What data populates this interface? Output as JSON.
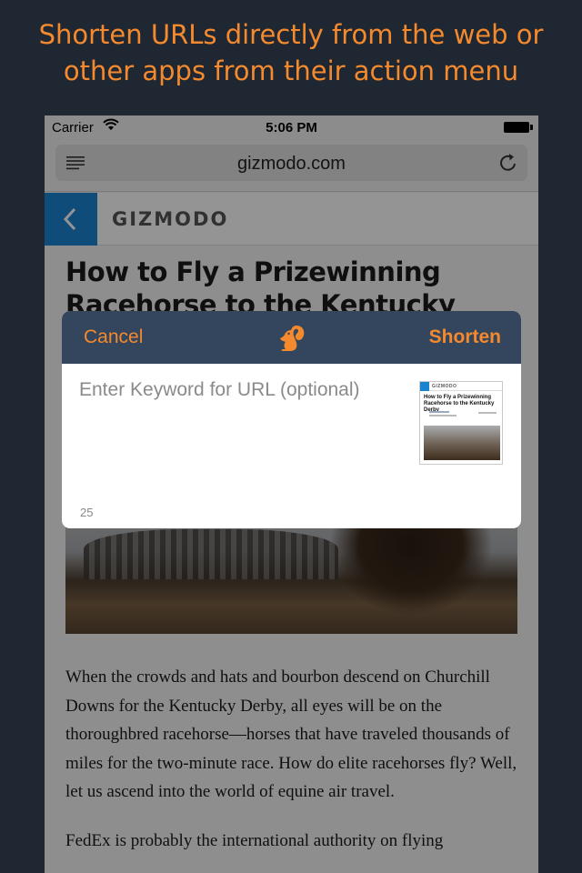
{
  "headline": {
    "line1": "Shorten URLs directly from the web or",
    "line2": "other apps from their action menu"
  },
  "status_bar": {
    "carrier": "Carrier",
    "time": "5:06 PM"
  },
  "browser": {
    "address": "gizmodo.com",
    "reader_icon": "reader-list-icon",
    "reload_icon": "reload-icon"
  },
  "site": {
    "logo": "GIZMODO",
    "back_icon": "chevron-left-icon"
  },
  "article": {
    "title": "How to Fly a Prizewinning Racehorse to the Kentucky Derby",
    "paragraphs": [
      "When the crowds and hats and bourbon descend on Churchill Downs for the Kentucky Derby, all eyes will be on the thoroughbred racehorse—horses that have traveled thousands of miles for the two-minute race. How do elite racehorses fly? Well, let us ascend into the world of equine air travel.",
      "FedEx is probably the international authority on flying"
    ]
  },
  "share_sheet": {
    "cancel_label": "Cancel",
    "shorten_label": "Shorten",
    "app_icon": "squirrel-icon",
    "keyword_placeholder": "Enter Keyword for URL (optional)",
    "keyword_value": "",
    "char_count": "25",
    "thumbnail": {
      "logo": "GIZMODO",
      "title": "How to Fly a Prizewinning Racehorse to the Kentucky Derby"
    }
  },
  "colors": {
    "accent": "#f4892d",
    "background": "#1e2732",
    "sheet_bar": "#33465d",
    "link_blue": "#1a83d0"
  }
}
